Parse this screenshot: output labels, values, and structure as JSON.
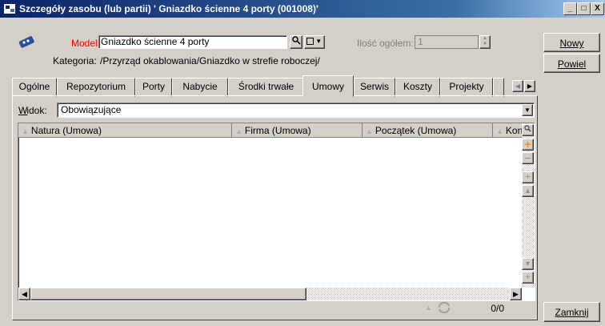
{
  "window": {
    "title": "Szczegóły zasobu (lub partii) ' Gniazdko ścienne 4 porty (001008)'",
    "controls": [
      "_",
      "□",
      "X"
    ]
  },
  "header": {
    "model_label": "Model:",
    "model_value": "Gniazdko ścienne 4 porty",
    "quantity_label": "Ilość ogółem:",
    "quantity_value": "1",
    "category_label": "Kategoria:",
    "category_value": "/Przyrząd okablowania/Gniazdko w strefie roboczej/"
  },
  "tabs": [
    {
      "label": "Ogólne"
    },
    {
      "label": "Repozytorium"
    },
    {
      "label": "Porty"
    },
    {
      "label": "Nabycie"
    },
    {
      "label": "Środki trwałe"
    },
    {
      "label": "Umowy"
    },
    {
      "label": "Serwis"
    },
    {
      "label": "Koszty"
    },
    {
      "label": "Projekty"
    }
  ],
  "active_tab": "Umowy",
  "view": {
    "label": "Widok:",
    "value": "Obowiązujące"
  },
  "table": {
    "columns": [
      "Natura (Umowa)",
      "Firma (Umowa)",
      "Początek (Umowa)",
      "Kon"
    ],
    "rows": [],
    "counter": "0/0"
  },
  "side_buttons": {
    "new": "Nowy",
    "duplicate": "Powiel",
    "close": "Zamknij"
  }
}
